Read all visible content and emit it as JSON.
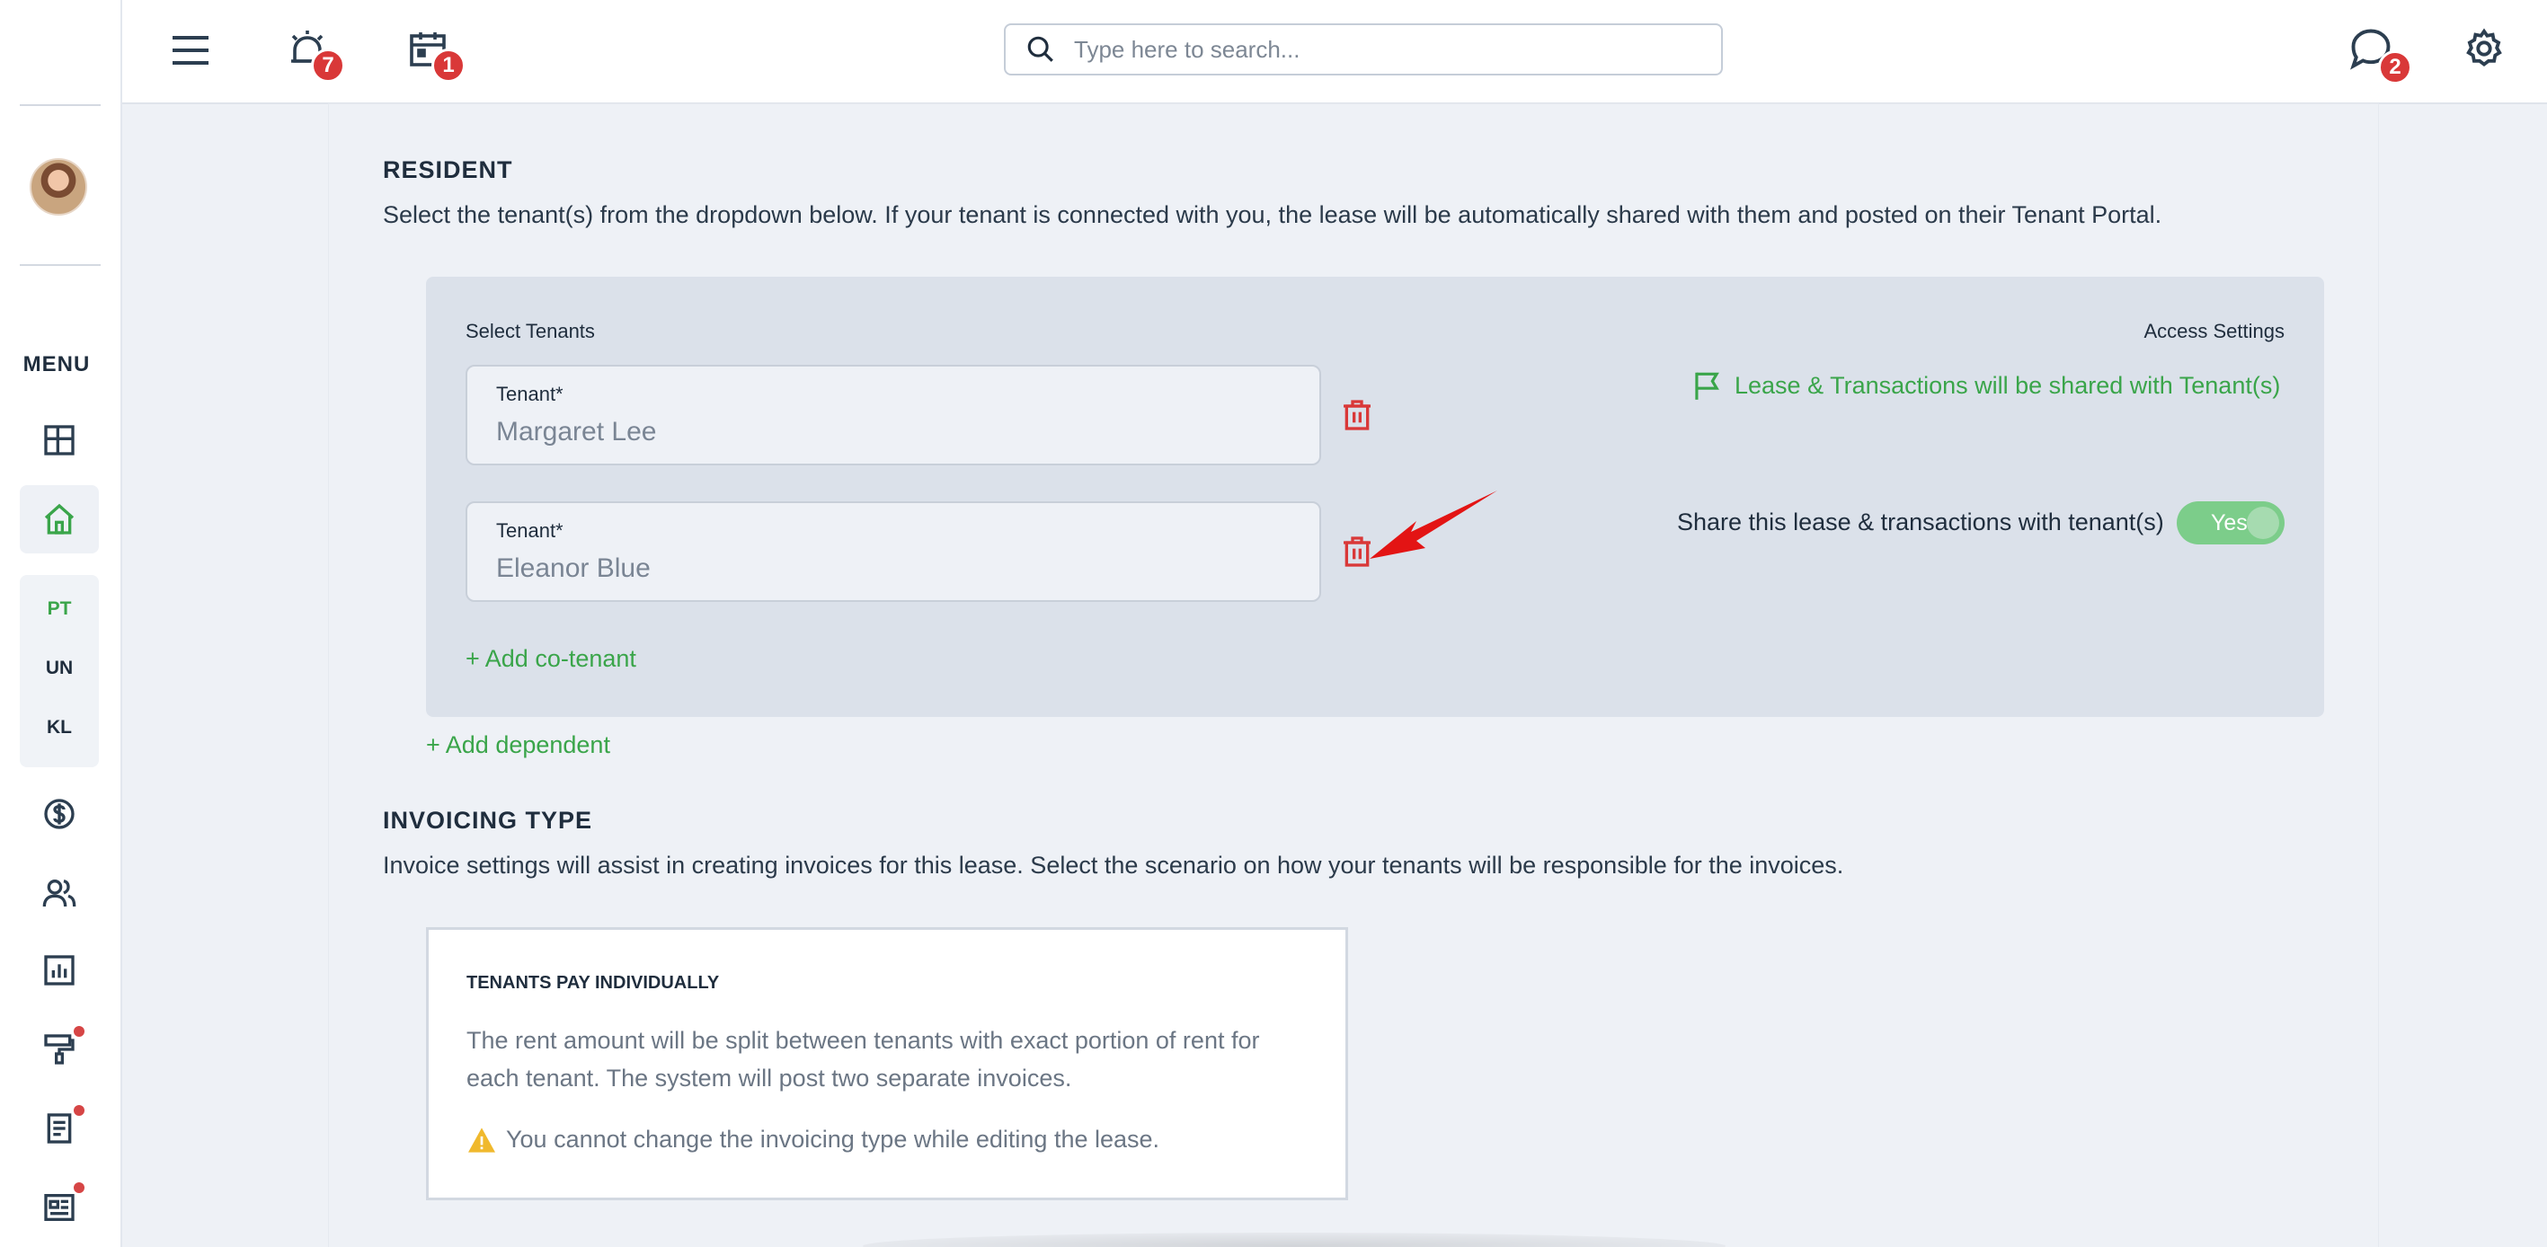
{
  "sidebar": {
    "menu_label": "MENU",
    "sub_items": [
      "PT",
      "UN",
      "KL"
    ],
    "icons": [
      "dashboard-icon",
      "home-icon",
      "dollar-icon",
      "people-icon",
      "report-icon",
      "maintenance-icon",
      "document-icon",
      "news-icon"
    ],
    "active_color": "#3aa54a"
  },
  "header": {
    "alarm_badge": "7",
    "calendar_badge": "1",
    "chat_badge": "2",
    "search_placeholder": "Type here to search..."
  },
  "resident": {
    "title": "RESIDENT",
    "description": "Select the tenant(s) from the dropdown below. If your tenant is connected with you, the lease will be automatically shared with them and posted on their Tenant Portal.",
    "select_tenants_label": "Select Tenants",
    "access_settings_label": "Access Settings",
    "shared_notice": "Lease & Transactions will be shared with Tenant(s)",
    "share_label": "Share this lease & transactions with tenant(s)",
    "share_toggle": "Yes",
    "tenants": [
      {
        "label": "Tenant*",
        "value": "Margaret Lee"
      },
      {
        "label": "Tenant*",
        "value": "Eleanor Blue"
      }
    ],
    "add_cotenant": "+ Add co-tenant",
    "add_dependent": "+ Add dependent"
  },
  "invoicing": {
    "title": "INVOICING TYPE",
    "description": "Invoice settings will assist in creating invoices for this lease. Select the scenario on how your tenants will be responsible for the invoices.",
    "option_title": "TENANTS PAY INDIVIDUALLY",
    "option_desc": "The rent amount will be split between tenants with exact portion of rent for each tenant. The system will post two separate invoices.",
    "warning": "You cannot change the invoicing type while editing the lease."
  },
  "colors": {
    "accent_green": "#3aa54a",
    "danger_red": "#d93838",
    "toggle_green": "#7ccd8a"
  }
}
